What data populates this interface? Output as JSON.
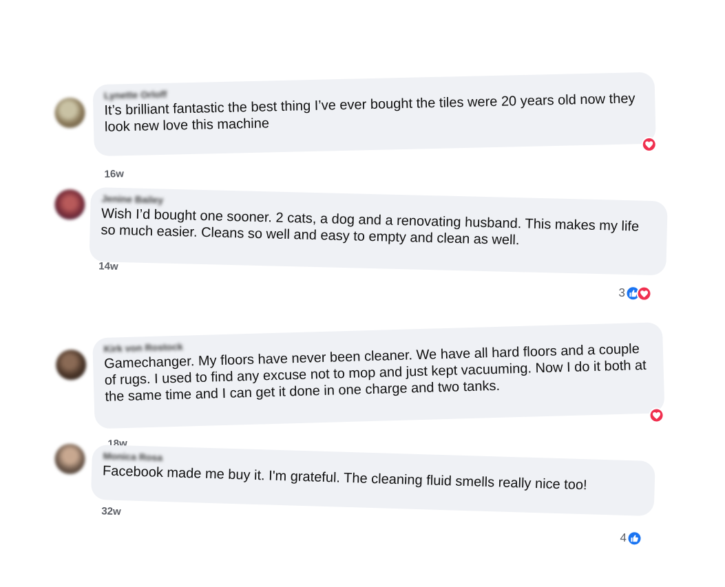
{
  "colors": {
    "bubble": "#eff1f5",
    "love": "#f0304f",
    "like": "#1a74f2",
    "meta": "#5c5f66"
  },
  "comments": [
    {
      "author": "Lynette Orloff",
      "text": "It’s brilliant fantastic the best thing I’ve ever   bought the tiles were 20 years old now they look new love this machine",
      "time": "16w",
      "reaction_count": "",
      "reactions": [
        "love-icon"
      ]
    },
    {
      "author": "Jenine Bailey",
      "text": "Wish I’d bought one sooner. 2 cats, a dog and a renovating husband. This makes my life so much easier. Cleans so well and easy to empty and clean as well.",
      "time": "14w",
      "reaction_count": "3",
      "reactions": [
        "like-icon",
        "love-icon"
      ]
    },
    {
      "author": "Kirk von Rostock",
      "text": "Gamechanger. My floors have never been cleaner. We have all hard floors and a couple of rugs. I used to find any excuse not to mop and just kept vacuuming. Now I do it both at the same time and I can get it done in one charge and two tanks.",
      "time": "18w",
      "reaction_count": "",
      "reactions": [
        "love-icon"
      ]
    },
    {
      "author": "Monica Rosa",
      "text": "Facebook made me buy it. I'm grateful. The cleaning fluid smells really nice too!",
      "time": "32w",
      "reaction_count": "4",
      "reactions": [
        "like-icon"
      ]
    }
  ]
}
